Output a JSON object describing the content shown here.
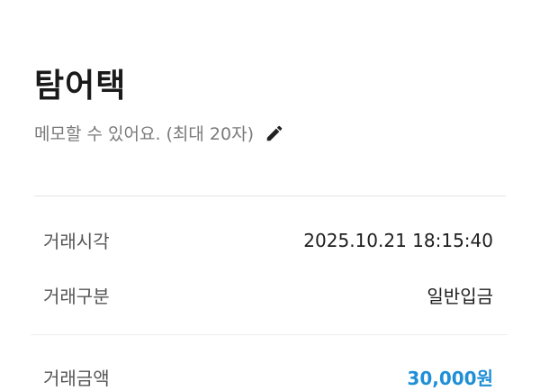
{
  "header": {
    "title": "탐어택"
  },
  "memo": {
    "placeholder_text": "메모할 수 있어요. (최대 20자)",
    "edit_icon": "pencil-icon"
  },
  "details": {
    "time_label": "거래시각",
    "time_value": "2025.10.21 18:15:40",
    "type_label": "거래구분",
    "type_value": "일반입금",
    "amount_label": "거래금액",
    "amount_value": "30,000원"
  },
  "colors": {
    "amount_accent": "#1f8fd6"
  }
}
